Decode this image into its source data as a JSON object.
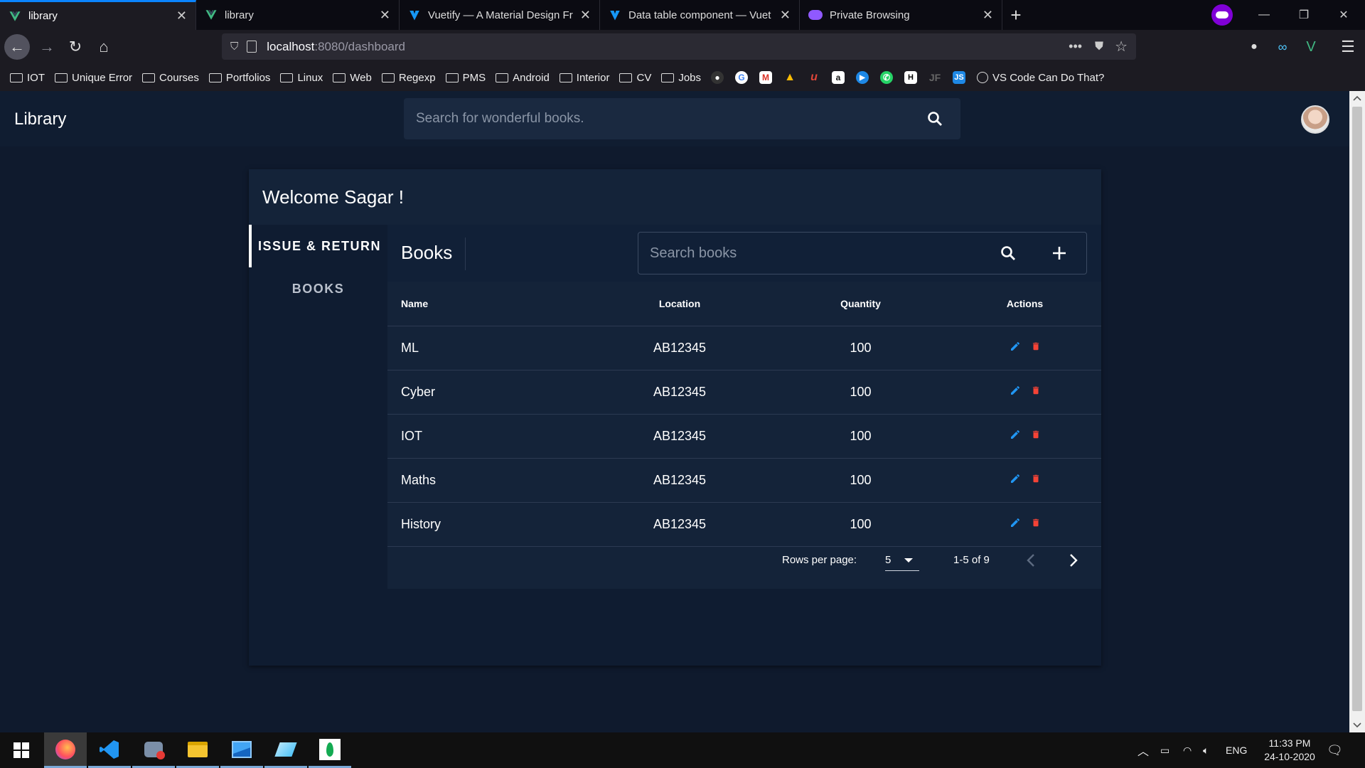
{
  "browser": {
    "tabs": [
      {
        "title": "library",
        "active": true
      },
      {
        "title": "library",
        "active": false
      },
      {
        "title": "Vuetify — A Material Design Fr",
        "active": false
      },
      {
        "title": "Data table component — Vuet",
        "active": false
      },
      {
        "title": "Private Browsing",
        "active": false
      }
    ],
    "url_host": "localhost",
    "url_path": ":8080/dashboard",
    "bookmarks_folders": [
      "IOT",
      "Unique Error",
      "Courses",
      "Portfolios",
      "Linux",
      "Web",
      "Regexp",
      "PMS",
      "Android",
      "Interior",
      "CV",
      "Jobs"
    ],
    "bookmark_site": "VS Code Can Do That?",
    "bookmark_icons": [
      "github-icon",
      "google-icon",
      "gmail-icon",
      "drive-icon",
      "scribd-icon",
      "amazon-icon",
      "play-icon",
      "whatsapp-icon",
      "hackerrank-icon",
      "jf-icon",
      "js-icon"
    ],
    "bookmark_icon_text": {
      "amazon": "a",
      "hackerrank": "H",
      "jf": "JF",
      "js": "JS"
    }
  },
  "app": {
    "title": "Library",
    "search_placeholder": "Search for wonderful books."
  },
  "card": {
    "welcome": "Welcome Sagar !",
    "side_tabs": [
      "ISSUE & RETURN",
      "BOOKS"
    ]
  },
  "books": {
    "title": "Books",
    "search_placeholder": "Search books",
    "headers": [
      "Name",
      "Location",
      "Quantity",
      "Actions"
    ],
    "rows": [
      {
        "name": "ML",
        "location": "AB12345",
        "quantity": "100"
      },
      {
        "name": "Cyber",
        "location": "AB12345",
        "quantity": "100"
      },
      {
        "name": "IOT",
        "location": "AB12345",
        "quantity": "100"
      },
      {
        "name": "Maths",
        "location": "AB12345",
        "quantity": "100"
      },
      {
        "name": "History",
        "location": "AB12345",
        "quantity": "100"
      }
    ],
    "rows_per_page_label": "Rows per page:",
    "rows_per_page_value": "5",
    "range": "1-5 of 9"
  },
  "taskbar": {
    "lang": "ENG",
    "time": "11:33 PM",
    "date": "24-10-2020"
  },
  "colors": {
    "edit": "#2196f3",
    "delete": "#f44336",
    "accent": "#0a84ff"
  }
}
